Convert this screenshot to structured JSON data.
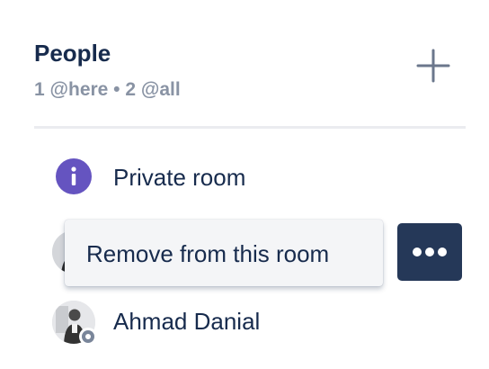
{
  "people": {
    "title": "People",
    "subtitle": "1 @here • 2 @all",
    "add_icon": "plus-icon"
  },
  "items": [
    {
      "label": "Private room",
      "icon": "info-icon",
      "icon_color": "#6554c0"
    },
    {
      "label": "Ahmad Danial",
      "icon": "avatar",
      "presence": "offline"
    }
  ],
  "context_menu": {
    "items": [
      {
        "label": "Remove from this room"
      }
    ]
  },
  "more_button": {
    "icon": "more-horizontal-icon",
    "color": "#253858"
  },
  "colors": {
    "text_primary": "#172b4d",
    "text_subtle": "#8993a4",
    "accent_purple": "#6554c0",
    "dark_button": "#253858"
  }
}
